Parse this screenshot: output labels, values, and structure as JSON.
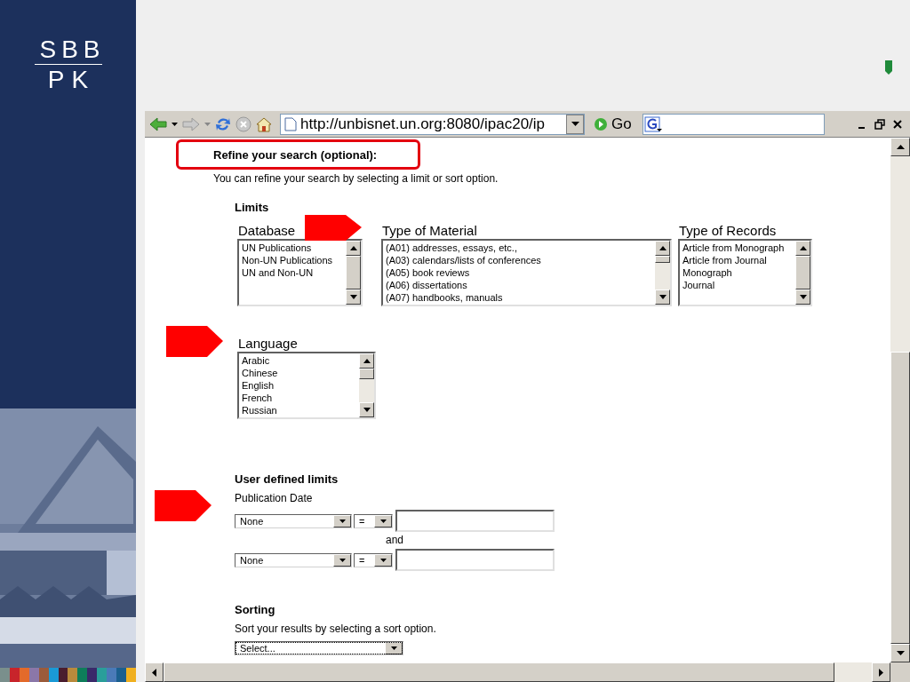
{
  "slide": {
    "logo": {
      "line_1": "SBB",
      "line_2": "PK"
    }
  },
  "browser": {
    "address": "http://unbisnet.un.org:8080/ipac20/ip",
    "go_label": "Go"
  },
  "page": {
    "heading": "Refine your search (optional):",
    "intro": "You can refine your search by selecting a limit or sort option.",
    "limits": {
      "heading": "Limits",
      "lists": [
        {
          "label": "Database",
          "items": [
            "UN Publications",
            "Non-UN Publications",
            "UN and Non-UN"
          ]
        },
        {
          "label": "Type of Material",
          "items": [
            "(A01) addresses, essays, etc.,",
            "(A03) calendars/lists of conferences",
            "(A05) book reviews",
            "(A06) dissertations",
            "(A07) handbooks, manuals"
          ]
        },
        {
          "label": "Type of Records",
          "items": [
            "Article from Monograph",
            "Article from Journal",
            "Monograph",
            "Journal"
          ]
        }
      ],
      "language": {
        "label": "Language",
        "items": [
          "Arabic",
          "Chinese",
          "English",
          "French",
          "Russian"
        ]
      }
    },
    "user_limits": {
      "heading": "User defined limits",
      "label": "Publication Date",
      "rows": [
        {
          "field": "None",
          "operator": "=",
          "value_placeholder": ""
        },
        {
          "field": "None",
          "operator": "="
        }
      ],
      "joiner": "and"
    },
    "sorting": {
      "heading": "Sorting",
      "intro": "Sort your results by selecting a sort option.",
      "select": "Select..."
    }
  }
}
